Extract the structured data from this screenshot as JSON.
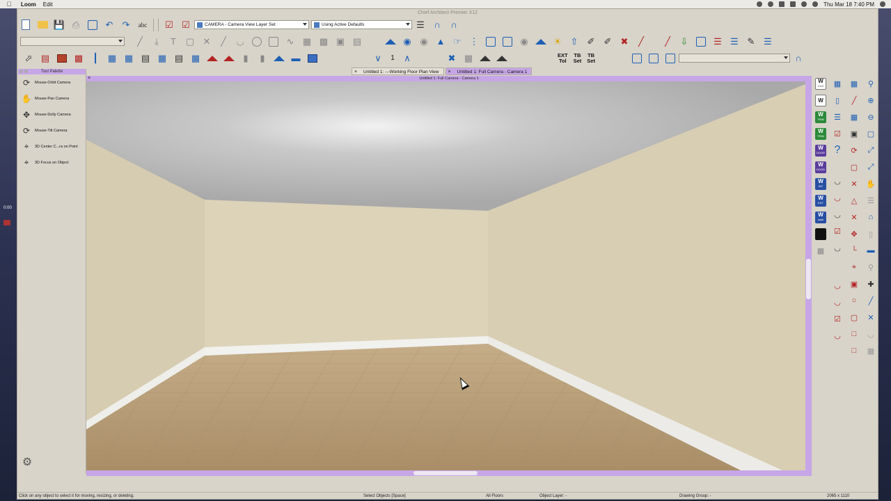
{
  "menubar": {
    "app": "Loom",
    "items": [
      "Edit"
    ],
    "clock": "Thu Mar 18  7:40 PM"
  },
  "desktop": {
    "timer": "0:00"
  },
  "window": {
    "title": "Chief Architect Premier X12"
  },
  "toolbar": {
    "layer_set": "CAMERA - Camera View Layer Set",
    "defaults": "Using Active Defaults",
    "spell_label": "abc",
    "floor_number": "1",
    "ext_label": "EXT",
    "tol_label": "Tol",
    "tb_label": "TB",
    "set_label": "Set"
  },
  "tabs": [
    {
      "label": "Untitled 1:  ---Working Floor Plan View",
      "active": false
    },
    {
      "label": "Untitled 1: Full Camera - Camera 1",
      "active": true
    }
  ],
  "palette": {
    "title": "Tool Palette",
    "items": [
      {
        "label": "Mouse-Orbit Camera",
        "icon": "orbit-camera-icon"
      },
      {
        "label": "Mouse-Pan Camera",
        "icon": "hand-icon"
      },
      {
        "label": "Mouse-Dolly Camera",
        "icon": "dolly-icon"
      },
      {
        "label": "Mouse-Tilt Camera",
        "icon": "tilt-icon"
      },
      {
        "label": "3D Center C...ra on Point",
        "icon": "center-point-icon"
      },
      {
        "label": "3D Focus on Object",
        "icon": "focus-object-icon"
      }
    ]
  },
  "view": {
    "title": "Untitled 1: Full Camera - Camera 1"
  },
  "rightbar": {
    "w_badges": [
      {
        "top": "W",
        "bottom": "CLG",
        "color": "white"
      },
      {
        "top": "W",
        "bottom": "",
        "color": "white"
      },
      {
        "top": "W",
        "bottom": "TRIM",
        "color": "green"
      },
      {
        "top": "W",
        "bottom": "TRIM",
        "color": "green"
      },
      {
        "top": "W",
        "bottom": "DOOR",
        "color": "purple"
      },
      {
        "top": "W",
        "bottom": "DOOR",
        "color": "purple"
      },
      {
        "top": "W",
        "bottom": "INT",
        "color": "blue"
      },
      {
        "top": "W",
        "bottom": "EXT",
        "color": "blue"
      },
      {
        "top": "W",
        "bottom": "sash",
        "color": "blue"
      }
    ]
  },
  "status": {
    "hint": "Click on any object to select it for moving, resizing, or deleting.",
    "mode": "Select Objects [Space]",
    "floors": "All Floors",
    "object_layer": "Object Layer: -",
    "drawing_group": "Drawing Group: -",
    "size": "2065 x 1110"
  },
  "colors": {
    "accent": "#c6a6e6",
    "wall": "#d9d0b4",
    "floor": "#b89f7c",
    "ceiling": "#b9b9b9"
  }
}
